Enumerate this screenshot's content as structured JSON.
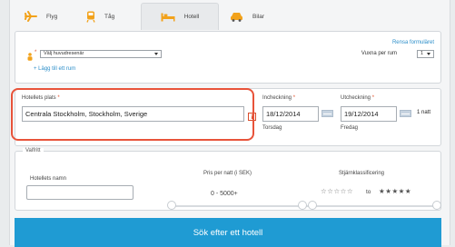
{
  "tabs": [
    {
      "label": "Flyg",
      "icon": "airplane-icon"
    },
    {
      "label": "Tåg",
      "icon": "train-icon"
    },
    {
      "label": "Hotell",
      "icon": "hotel-bed-icon",
      "active": true
    },
    {
      "label": "Bilar",
      "icon": "car-icon"
    }
  ],
  "travelers": {
    "select_value": "Välj huvudresenär",
    "add_room": "+ Lägg till ett rum",
    "clear_form": "Rensa formuläret",
    "adults_per_room_label": "Vuxna per rum",
    "adults_per_room_value": "1"
  },
  "location": {
    "label": "Hotellets plats",
    "value": "Centrala Stockholm, Stockholm, Sverige"
  },
  "checkin": {
    "label": "Incheckning",
    "value": "18/12/2014",
    "weekday": "Torsdag"
  },
  "checkout": {
    "label": "Utcheckning",
    "value": "19/12/2014",
    "weekday": "Fredag"
  },
  "nights": "1 natt",
  "optional": {
    "legend": "Valfritt",
    "hotel_name_label": "Hotellets namn",
    "price_label": "Pris per natt (i SEK)",
    "price_range": "0 - 5000+",
    "stars_label": "Stjärnklassificering",
    "stars_from": "☆☆☆☆☆",
    "stars_to_word": "to",
    "stars_to": "★★★★★"
  },
  "search_button": "Sök efter ett hotell",
  "colors": {
    "accent": "#1f9bd3",
    "highlight": "#e8533a",
    "required": "#e1522c",
    "link": "#2c8ec9"
  }
}
